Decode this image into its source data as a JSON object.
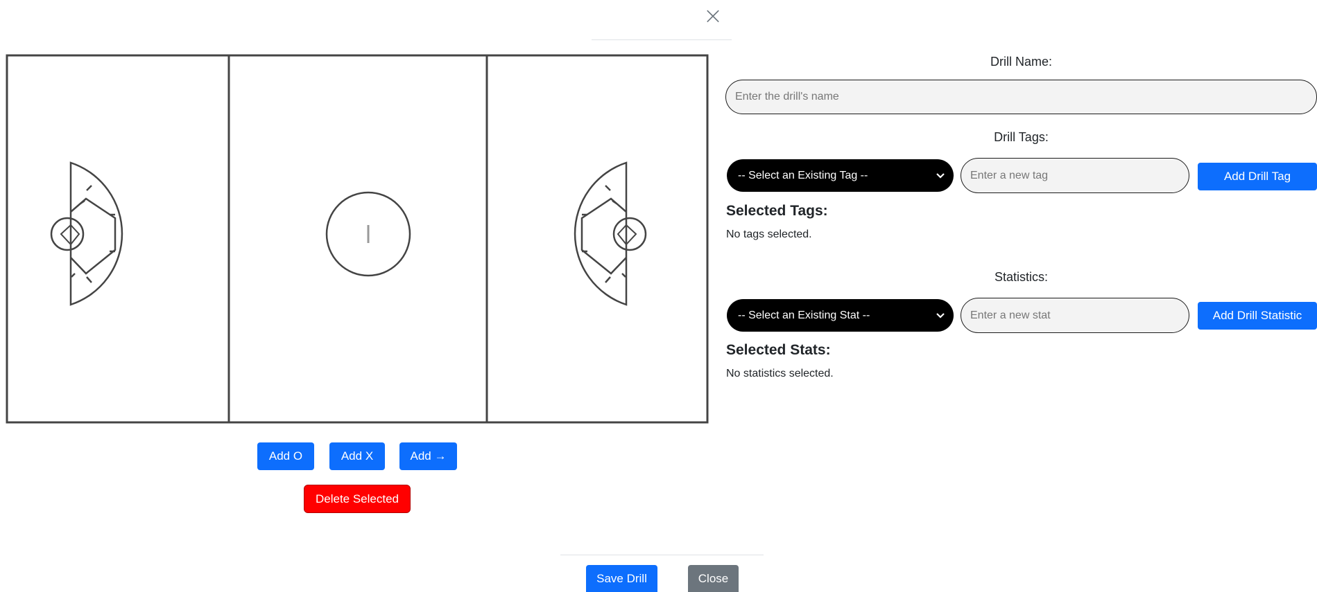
{
  "modal": {
    "close_icon": "×"
  },
  "canvas": {
    "name": "lacrosse-field",
    "buttons": {
      "add_o": "Add O",
      "add_x": "Add X",
      "add_arrow": "Add →",
      "delete_selected": "Delete Selected"
    }
  },
  "form": {
    "drill_name_label": "Drill Name:",
    "drill_name_placeholder": "Enter the drill's name",
    "drill_tags_label": "Drill Tags:",
    "tag_select_value": "-- Select an Existing Tag --",
    "new_tag_placeholder": "Enter a new tag",
    "add_tag_button": "Add Drill Tag",
    "selected_tags_heading": "Selected Tags:",
    "selected_tags_empty": "No tags selected.",
    "statistics_label": "Statistics:",
    "stat_select_value": "-- Select an Existing Stat --",
    "new_stat_placeholder": "Enter a new stat",
    "add_stat_button": "Add Drill Statistic",
    "selected_stats_heading": "Selected Stats:",
    "selected_stats_empty": "No statistics selected."
  },
  "footer": {
    "save_button": "Save Drill",
    "close_button": "Close"
  },
  "colors": {
    "primary": "#0d6efd",
    "danger": "#ff0000",
    "secondary": "#6c757d",
    "select_bg": "#000000",
    "input_bg": "#f3f3f3"
  }
}
